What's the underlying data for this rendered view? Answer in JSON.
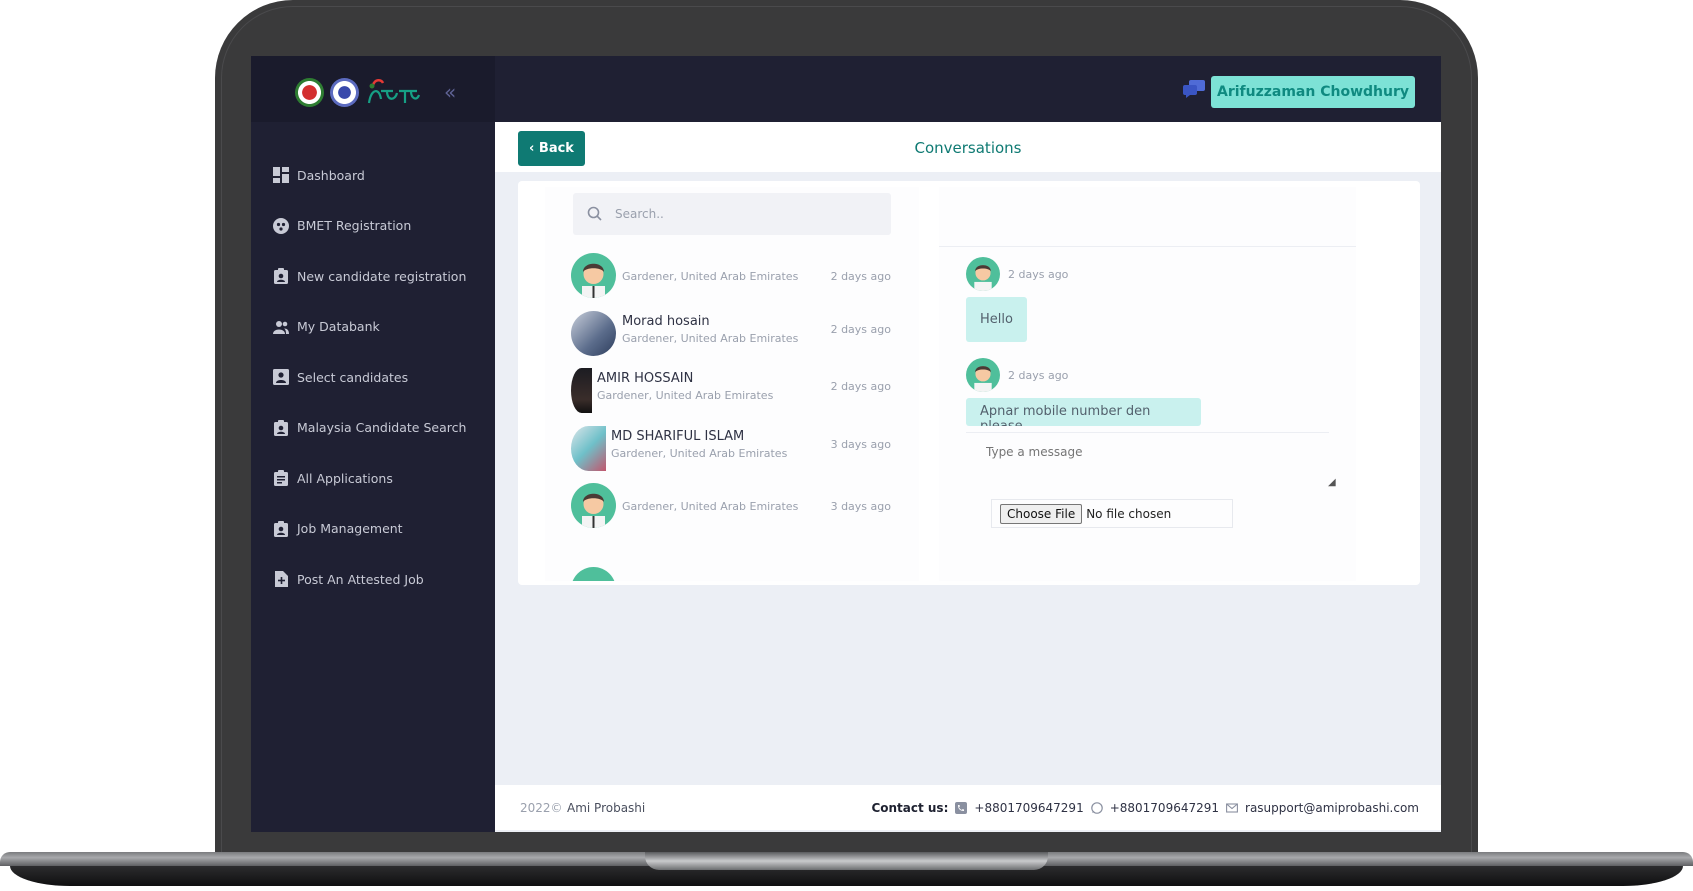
{
  "sidebar": {
    "items": [
      {
        "label": "Dashboard",
        "icon": "dashboard-icon"
      },
      {
        "label": "BMET Registration",
        "icon": "registration-icon"
      },
      {
        "label": "New candidate registration",
        "icon": "candidate-icon"
      },
      {
        "label": "My Databank",
        "icon": "people-icon"
      },
      {
        "label": "Select candidates",
        "icon": "profile-icon"
      },
      {
        "label": "Malaysia Candidate Search",
        "icon": "badge-icon"
      },
      {
        "label": "All Applications",
        "icon": "clipboard-icon"
      },
      {
        "label": "Job Management",
        "icon": "badge-icon"
      },
      {
        "label": "Post An Attested Job",
        "icon": "add-file-icon"
      }
    ]
  },
  "topbar": {
    "user_name": "Arifuzzaman Chowdhury"
  },
  "page": {
    "back_label": "‹ Back",
    "title": "Conversations"
  },
  "search": {
    "placeholder": "Search.."
  },
  "conversations": [
    {
      "name": "",
      "subtitle": "Gardener, United Arab Emirates",
      "time": "2 days ago",
      "avatar": "cartoon"
    },
    {
      "name": "Morad hosain",
      "subtitle": "Gardener, United Arab Emirates",
      "time": "2 days ago",
      "avatar": "photo"
    },
    {
      "name": "AMIR HOSSAIN",
      "subtitle": "Gardener, United Arab Emirates",
      "time": "2 days ago",
      "avatar": "photo"
    },
    {
      "name": "MD SHARIFUL ISLAM",
      "subtitle": "Gardener, United Arab Emirates",
      "time": "3 days ago",
      "avatar": "photo"
    },
    {
      "name": "",
      "subtitle": "Gardener, United Arab Emirates",
      "time": "3 days ago",
      "avatar": "cartoon"
    }
  ],
  "chat": {
    "messages": [
      {
        "time": "2 days ago",
        "text": "Hello"
      },
      {
        "time": "2 days ago",
        "text": "Apnar mobile number den please"
      }
    ],
    "input_placeholder": "Type a message",
    "file_button": "Choose File",
    "file_status": "No file chosen"
  },
  "footer": {
    "year": "2022©",
    "brand": "Ami Probashi",
    "contact_label": "Contact us:",
    "phone": "+8801709647291",
    "whatsapp": "+8801709647291",
    "email": "rasupport@amiprobashi.com"
  },
  "colors": {
    "sidebar_bg": "#1f2033",
    "accent": "#0f7a73",
    "user_button": "#7de2d6",
    "bubble": "#c9f1ee"
  }
}
